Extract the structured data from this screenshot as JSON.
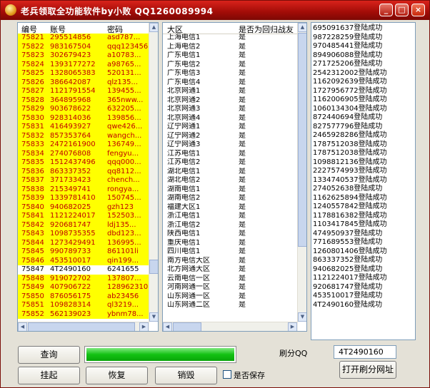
{
  "window": {
    "title": "老兵领取全功能软件by小败 QQ1260089994",
    "btn_min": "_",
    "btn_max": "□",
    "btn_close": "×"
  },
  "accounts": {
    "headers": [
      "编号",
      "账号",
      "密码"
    ],
    "rows": [
      [
        "75821",
        "295514856",
        "asd787..."
      ],
      [
        "75822",
        "983167504",
        "qqq123456"
      ],
      [
        "75823",
        "302679423",
        "a10783..."
      ],
      [
        "75824",
        "1393177272",
        "a98765..."
      ],
      [
        "75825",
        "1328065383",
        "520131..."
      ],
      [
        "75826",
        "386642087",
        "qlz135..."
      ],
      [
        "75827",
        "1121791554",
        "139455..."
      ],
      [
        "75828",
        "364895968",
        "365nww..."
      ],
      [
        "75829",
        "903678622",
        "632205..."
      ],
      [
        "75830",
        "928314036",
        "139856..."
      ],
      [
        "75831",
        "416493927",
        "qwe426..."
      ],
      [
        "75832",
        "857353764",
        "wangch..."
      ],
      [
        "75833",
        "2472161900",
        "136749..."
      ],
      [
        "75834",
        "274076808",
        "fengyu..."
      ],
      [
        "75835",
        "1512437496",
        "qqq000..."
      ],
      [
        "75836",
        "863337352",
        "qq8112..."
      ],
      [
        "75837",
        "371733423",
        "chench..."
      ],
      [
        "75838",
        "215349741",
        "rongya..."
      ],
      [
        "75839",
        "1339781410",
        "150745..."
      ],
      [
        "75840",
        "940682025",
        "gzh123"
      ],
      [
        "75841",
        "1121224017",
        "152503..."
      ],
      [
        "75842",
        "920681747",
        "ldj135..."
      ],
      [
        "75843",
        "1098735355",
        "dbd123..."
      ],
      [
        "75844",
        "1273429491",
        "136995..."
      ],
      [
        "75845",
        "990789733",
        "861101li"
      ],
      [
        "75846",
        "453510017",
        "qin199..."
      ],
      [
        "75847",
        "4T2490160",
        "6241655"
      ],
      [
        "75848",
        "919072702",
        "137807..."
      ],
      [
        "75849",
        "407906722",
        "128962310"
      ],
      [
        "75850",
        "876056175",
        "ab23456"
      ],
      [
        "75851",
        "109828314",
        "ql3219..."
      ],
      [
        "75852",
        "562139023",
        "ybnm78..."
      ]
    ],
    "highlight_row": "75847"
  },
  "regions": {
    "headers": [
      "大区",
      "是否为回归战友"
    ],
    "rows": [
      [
        "上海电信1",
        "是"
      ],
      [
        "上海电信2",
        "是"
      ],
      [
        "广东电信1",
        "是"
      ],
      [
        "广东电信2",
        "是"
      ],
      [
        "广东电信3",
        "是"
      ],
      [
        "广东电信4",
        "是"
      ],
      [
        "北京网通1",
        "是"
      ],
      [
        "北京网通2",
        "是"
      ],
      [
        "北京网通3",
        "是"
      ],
      [
        "北京网通4",
        "是"
      ],
      [
        "辽宁网通1",
        "是"
      ],
      [
        "辽宁网通2",
        "是"
      ],
      [
        "辽宁网通3",
        "是"
      ],
      [
        "江苏电信1",
        "是"
      ],
      [
        "江苏电信2",
        "是"
      ],
      [
        "湖北电信1",
        "是"
      ],
      [
        "湖北电信2",
        "是"
      ],
      [
        "湖南电信1",
        "是"
      ],
      [
        "湖南电信2",
        "是"
      ],
      [
        "福建大区1",
        "是"
      ],
      [
        "浙江电信1",
        "是"
      ],
      [
        "浙江电信2",
        "是"
      ],
      [
        "陕西电信1",
        "是"
      ],
      [
        "重庆电信1",
        "是"
      ],
      [
        "四川电信1",
        "是"
      ],
      [
        "南方电信大区",
        "是"
      ],
      [
        "北方网通大区",
        "是"
      ],
      [
        "云南电信一区",
        "是"
      ],
      [
        "河南网通一区",
        "是"
      ],
      [
        "山东网通一区",
        "是"
      ],
      [
        "山东网通二区",
        "是"
      ]
    ]
  },
  "log": [
    "695091637登陆成功",
    "987228259登陆成功",
    "970485441登陆成功",
    "894906088登陆成功",
    "271725206登陆成功",
    "2542312002登陆成功",
    "1162092639登陆成功",
    "1727956772登陆成功",
    "1162006905登陆成功",
    "1060134304登陆成功",
    "872440694登陆成功",
    "827577796登陆成功",
    "2465928286登陆成功",
    "1787512038登陆成功",
    "1787512038登陆成功",
    "1098812136登陆成功",
    "2227574993登陆成功",
    "1334740537登陆成功",
    "274052638登陆成功",
    "1162625894登陆成功",
    "1240557842登陆成功",
    "1178816382登陆成功",
    "1103417845登陆成功",
    "474950937登陆成功",
    "771689553登陆成功",
    "1260801406登陆成功",
    "863337352登陆成功",
    "940682025登陆成功",
    "1121224017登陆成功",
    "920681747登陆成功",
    "453510017登陆成功",
    "4T2490160登陆成功"
  ],
  "controls": {
    "query_label": "查询",
    "progress_percent": 100,
    "progress_color": "#13c213",
    "refresh_qq_label": "刷分QQ",
    "refresh_qq_value": "4T2490160",
    "suspend_label": "挂起",
    "restore_label": "恢复",
    "destroy_label": "销毁",
    "save_label": "是否保存",
    "open_url_label": "打开刷分网址"
  }
}
